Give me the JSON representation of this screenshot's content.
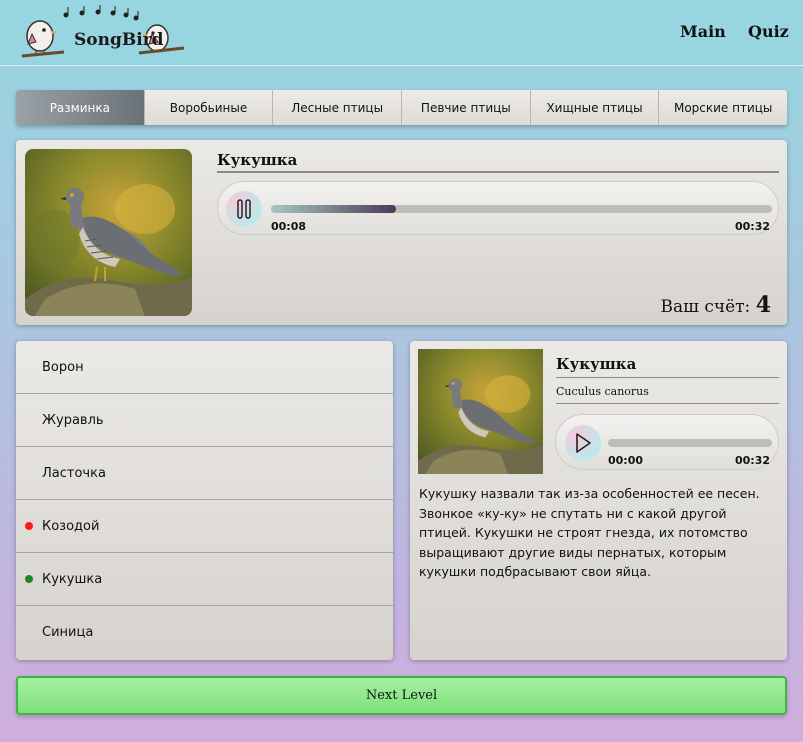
{
  "header": {
    "logo_text": "SongBird",
    "nav": {
      "main": "Main",
      "quiz": "Quiz"
    }
  },
  "tabs": [
    {
      "label": "Разминка",
      "active": true
    },
    {
      "label": "Воробьиные",
      "active": false
    },
    {
      "label": "Лесные птицы",
      "active": false
    },
    {
      "label": "Певчие птицы",
      "active": false
    },
    {
      "label": "Хищные птицы",
      "active": false
    },
    {
      "label": "Морские птицы",
      "active": false
    }
  ],
  "question": {
    "title": "Кукушка",
    "player": {
      "current": "00:08",
      "duration": "00:32",
      "progress_fraction": 0.25,
      "state": "playing"
    },
    "score_label": "Ваш счёт:",
    "score_value": "4"
  },
  "answers": [
    {
      "label": "Ворон",
      "mark": ""
    },
    {
      "label": "Журавль",
      "mark": ""
    },
    {
      "label": "Ласточка",
      "mark": ""
    },
    {
      "label": "Козодой",
      "mark": "wrong"
    },
    {
      "label": "Кукушка",
      "mark": "correct"
    },
    {
      "label": "Синица",
      "mark": ""
    }
  ],
  "info": {
    "title": "Кукушка",
    "latin": "Cuculus canorus",
    "player": {
      "current": "00:00",
      "duration": "00:32",
      "progress_fraction": 0,
      "state": "paused"
    },
    "description": "Кукушку назвали так из-за особенностей ее песен. Звонкое «ку-ку» не спутать ни с какой другой птицей. Кукушки не строят гнезда, их потомство выращивают другие виды пернатых, которым кукушки подбрасывают свои яйца."
  },
  "next_button": "Next Level",
  "colors": {
    "accent_green": "#7fe07c",
    "wrong": "#ff1a1a",
    "correct": "#1b8a1b",
    "header_bg": "#97d6e0"
  }
}
